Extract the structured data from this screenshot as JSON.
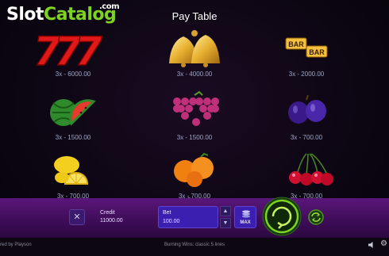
{
  "watermark": {
    "part1": "Slot",
    "part2": "Catalog",
    "suffix": ".com"
  },
  "title": "Pay Table",
  "symbols": [
    {
      "name": "seven",
      "payout": "3x - 6000.00"
    },
    {
      "name": "bells",
      "payout": "3x - 4000.00"
    },
    {
      "name": "bar-bar",
      "payout": "3x - 2000.00",
      "bar_text": "BAR"
    },
    {
      "name": "watermelon",
      "payout": "3x - 1500.00"
    },
    {
      "name": "grapes",
      "payout": "3x - 1500.00"
    },
    {
      "name": "plums",
      "payout": "3x - 700.00"
    },
    {
      "name": "lemon",
      "payout": "3x - 700.00"
    },
    {
      "name": "orange",
      "payout": "3x - 700.00"
    },
    {
      "name": "cherries",
      "payout": "3x - 700.00"
    }
  ],
  "page_dots": {
    "count": 2,
    "active": 0
  },
  "controls": {
    "close_glyph": "✕",
    "credit_label": "Credit",
    "credit_value": "11000.00",
    "bet_label": "Bet",
    "bet_value": "100.00",
    "bet_up_glyph": "▲",
    "bet_down_glyph": "▼",
    "max_label": "MAX"
  },
  "footer": {
    "provider": "red by Playson",
    "game_name": "Burning Wins: classic 5 lines",
    "settings_glyph": "⚙"
  },
  "colors": {
    "accent_green": "#7ed321",
    "bar_purple": "#4a1066",
    "bet_blue": "#3a1fb0",
    "payout_text": "#a0a8c8"
  }
}
